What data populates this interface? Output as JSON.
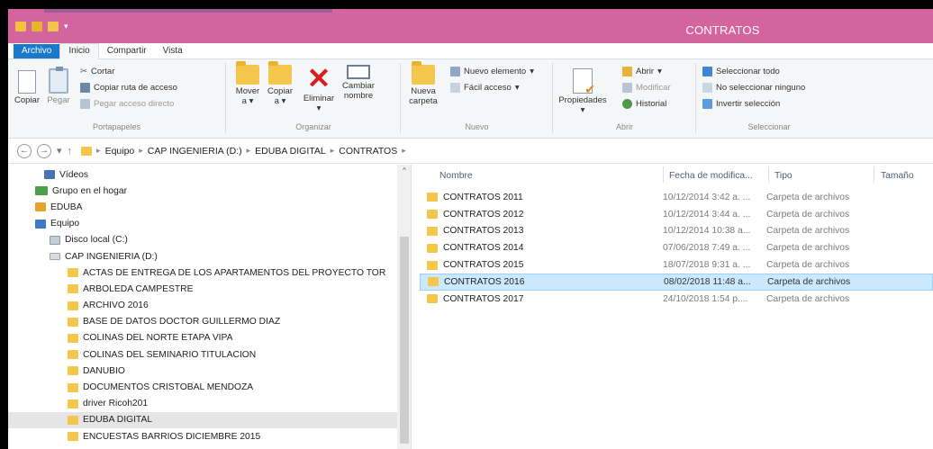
{
  "window": {
    "title": "CONTRATOS"
  },
  "tabs": [
    {
      "label": "Archivo"
    },
    {
      "label": "Inicio"
    },
    {
      "label": "Compartir"
    },
    {
      "label": "Vista"
    }
  ],
  "ribbon": {
    "portapapeles": {
      "label": "Portapapeles",
      "copiar": "Copiar",
      "pegar": "Pegar",
      "cortar": "Cortar",
      "copiar_ruta": "Copiar ruta de acceso",
      "pegar_acceso": "Pegar acceso directo"
    },
    "organizar": {
      "label": "Organizar",
      "mover": "Mover",
      "mover2": "a",
      "copiar": "Copiar",
      "copiar2": "a",
      "eliminar": "Eliminar",
      "cambiar": "Cambiar",
      "nombre": "nombre"
    },
    "nuevo": {
      "label": "Nuevo",
      "nueva": "Nueva",
      "carpeta": "carpeta",
      "nuevo_elemento": "Nuevo elemento",
      "facil_acceso": "Fácil acceso"
    },
    "abrir": {
      "label": "Abrir",
      "propiedades": "Propiedades",
      "abrir": "Abrir",
      "modificar": "Modificar",
      "historial": "Historial"
    },
    "seleccionar": {
      "label": "Seleccionar",
      "todo": "Seleccionar todo",
      "ninguno": "No seleccionar ninguno",
      "invertir": "Invertir selección"
    }
  },
  "address": {
    "crumbs": [
      "Equipo",
      "CAP INGENIERIA (D:)",
      "EDUBA DIGITAL",
      "CONTRATOS"
    ]
  },
  "nav": {
    "items": [
      {
        "label": "Vídeos",
        "icon": "videos-icon",
        "indent": 1
      },
      {
        "label": "Grupo en el hogar",
        "icon": "homegroup-icon",
        "indent": 0
      },
      {
        "label": "EDUBA",
        "icon": "user-icon",
        "indent": 0
      },
      {
        "label": "Equipo",
        "icon": "computer-icon",
        "indent": 0
      },
      {
        "label": "Disco local (C:)",
        "icon": "disk-icon",
        "indent": 1
      },
      {
        "label": "CAP INGENIERIA (D:)",
        "icon": "drive-icon",
        "indent": 1
      },
      {
        "label": "ACTAS DE ENTREGA DE LOS APARTAMENTOS DEL PROYECTO TOR",
        "icon": "folder-icon",
        "indent": 2
      },
      {
        "label": "ARBOLEDA CAMPESTRE",
        "icon": "folder-icon",
        "indent": 2
      },
      {
        "label": "ARCHIVO 2016",
        "icon": "folder-icon",
        "indent": 2
      },
      {
        "label": "BASE DE DATOS DOCTOR GUILLERMO DIAZ",
        "icon": "folder-icon",
        "indent": 2
      },
      {
        "label": "COLINAS DEL NORTE ETAPA VIPA",
        "icon": "folder-icon",
        "indent": 2
      },
      {
        "label": "COLINAS DEL SEMINARIO TITULACION",
        "icon": "folder-icon",
        "indent": 2
      },
      {
        "label": "DANUBIO",
        "icon": "folder-icon",
        "indent": 2
      },
      {
        "label": "DOCUMENTOS CRISTOBAL MENDOZA",
        "icon": "folder-icon",
        "indent": 2
      },
      {
        "label": "driver Ricoh201",
        "icon": "folder-icon",
        "indent": 2
      },
      {
        "label": "EDUBA DIGITAL",
        "icon": "folder-icon",
        "indent": 2,
        "selected": true
      },
      {
        "label": "ENCUESTAS BARRIOS DICIEMBRE 2015",
        "icon": "folder-icon",
        "indent": 2
      }
    ]
  },
  "columns": {
    "nombre": "Nombre",
    "fecha": "Fecha de modifica...",
    "tipo": "Tipo",
    "tamano": "Tamaño"
  },
  "files": [
    {
      "name": "CONTRATOS 2011",
      "date": "10/12/2014 3:42 a. ...",
      "type": "Carpeta de archivos"
    },
    {
      "name": "CONTRATOS 2012",
      "date": "10/12/2014 3:44 a. ...",
      "type": "Carpeta de archivos"
    },
    {
      "name": "CONTRATOS 2013",
      "date": "10/12/2014 10:38 a...",
      "type": "Carpeta de archivos"
    },
    {
      "name": "CONTRATOS 2014",
      "date": "07/06/2018 7:49 a. ...",
      "type": "Carpeta de archivos"
    },
    {
      "name": "CONTRATOS 2015",
      "date": "18/07/2018 9:31 a. ...",
      "type": "Carpeta de archivos"
    },
    {
      "name": "CONTRATOS 2016",
      "date": "08/02/2018 11:48 a...",
      "type": "Carpeta de archivos",
      "selected": true
    },
    {
      "name": "CONTRATOS 2017",
      "date": "24/10/2018 1:54 p....",
      "type": "Carpeta de archivos"
    }
  ],
  "colors": {
    "titlebar": "#d4649d",
    "file_tab": "#1979ca",
    "selection": "#cce8ff",
    "folder": "#f4c64c"
  }
}
